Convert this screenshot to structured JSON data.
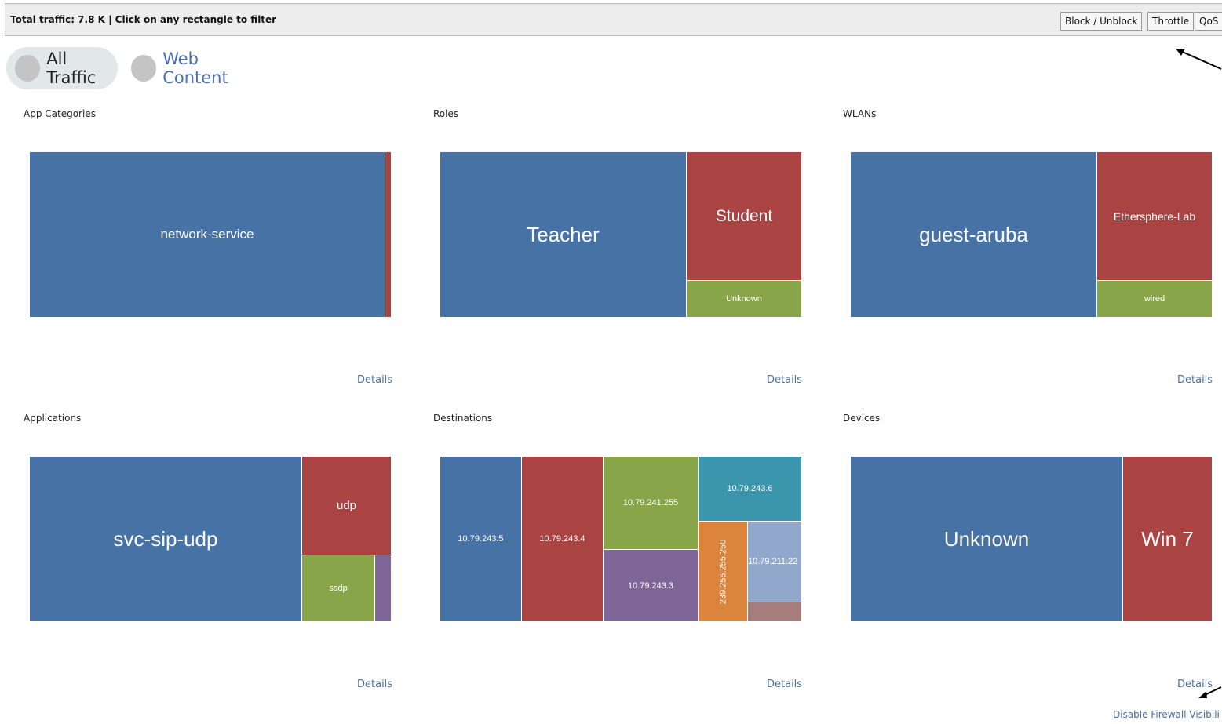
{
  "toolbar": {
    "summary": "Total traffic: 7.8 K | Click on any rectangle to filter",
    "buttons": [
      "Block / Unblock",
      "Throttle",
      "QoS"
    ]
  },
  "filters": {
    "all_traffic": "All Traffic",
    "web_content": "Web Content"
  },
  "panels": {
    "app_categories": {
      "title": "App Categories",
      "details": "Details",
      "cells": [
        "network-service",
        ""
      ]
    },
    "roles": {
      "title": "Roles",
      "details": "Details",
      "cells": [
        "Teacher",
        "Student",
        "Unknown"
      ]
    },
    "wlans": {
      "title": "WLANs",
      "details": "Details",
      "cells": [
        "guest-aruba",
        "Ethersphere-Lab",
        "wired"
      ]
    },
    "applications": {
      "title": "Applications",
      "details": "Details",
      "cells": [
        "svc-sip-udp",
        "udp",
        "ssdp",
        ""
      ]
    },
    "destinations": {
      "title": "Destinations",
      "details": "Details",
      "cells": [
        "10.79.243.5",
        "10.79.243.4",
        "10.79.241.255",
        "10.79.243.3",
        "10.79.243.6",
        "239.255.255.250",
        "10.79.211.22",
        ""
      ]
    },
    "devices": {
      "title": "Devices",
      "details": "Details",
      "cells": [
        "Unknown",
        "Win 7"
      ]
    }
  },
  "footer": {
    "disable_link": "Disable Firewall Visibili"
  },
  "colors": {
    "blue": "#4672a5",
    "red": "#a94442",
    "green": "#89a54a",
    "purple": "#7e6699",
    "teal": "#3b96ad",
    "orange": "#db843d",
    "light_blue": "#92a8cd",
    "rose": "#a47d7c",
    "link": "#4a6fa5"
  }
}
